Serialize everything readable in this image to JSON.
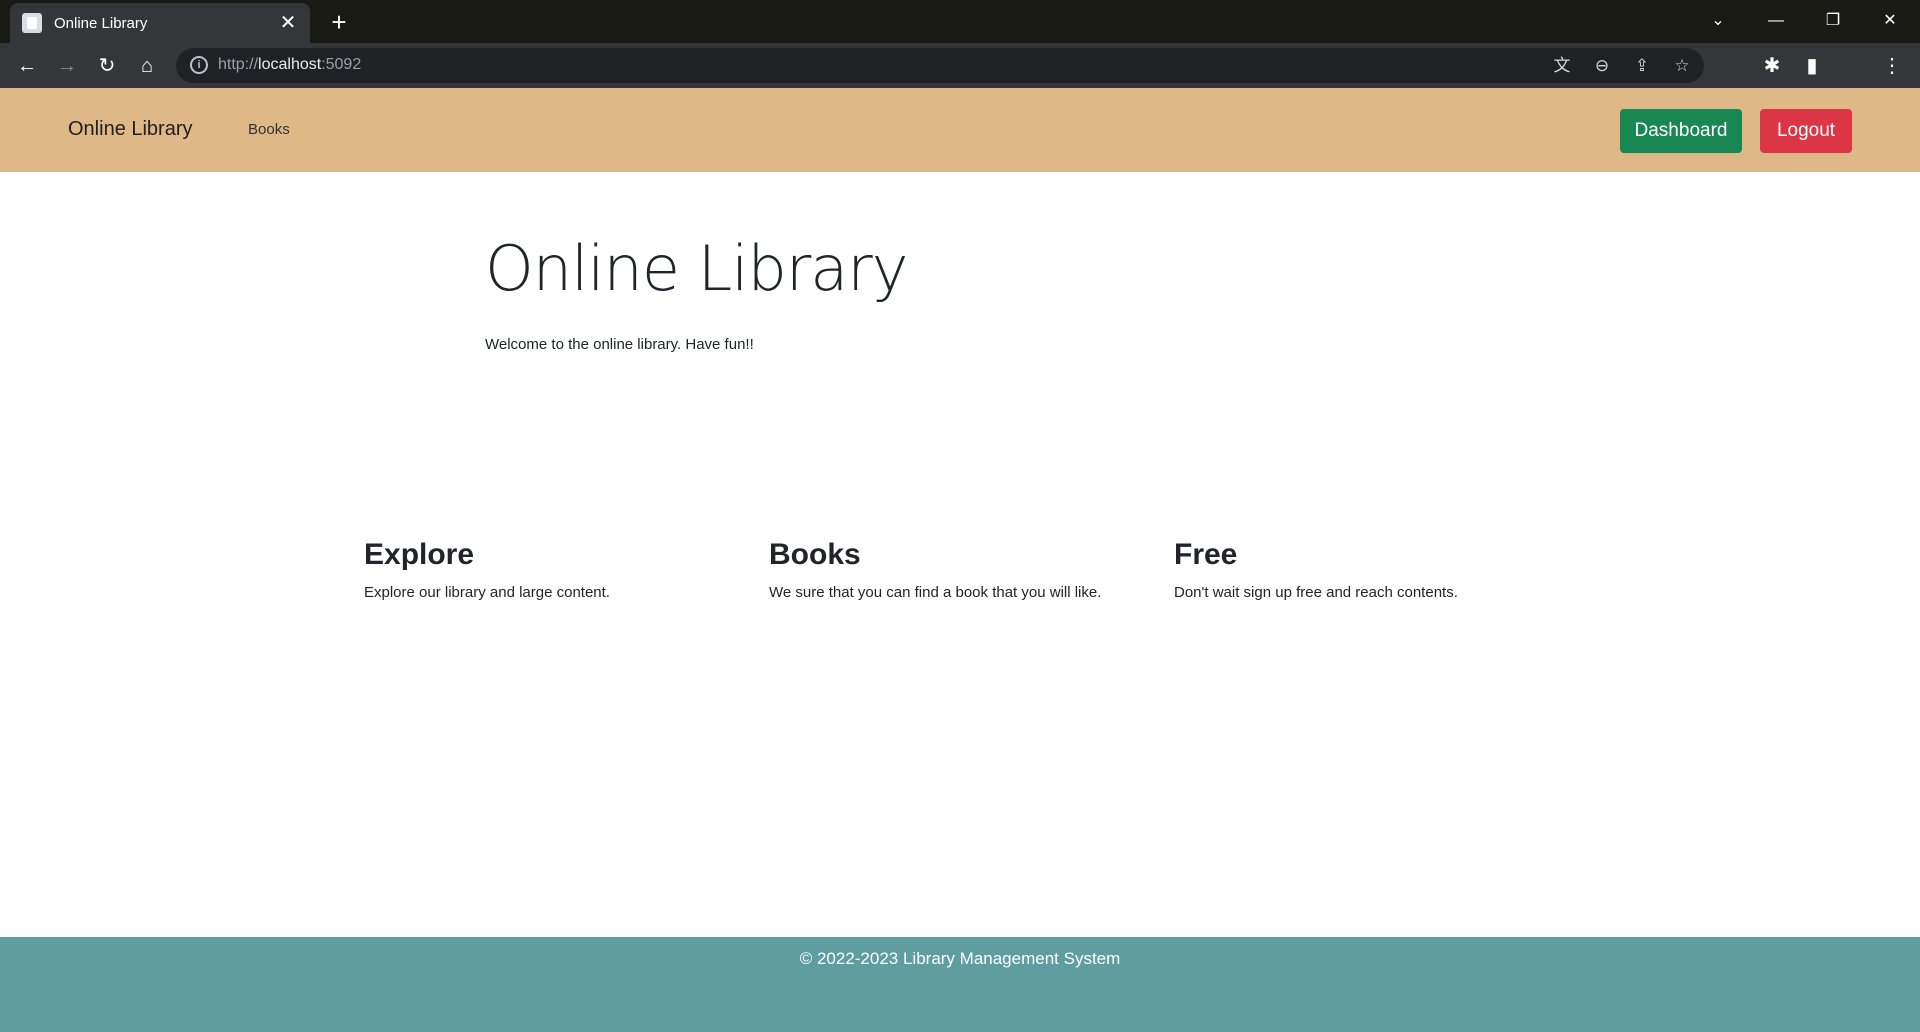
{
  "browser": {
    "tab_title": "Online Library",
    "tab_close": "✕",
    "new_tab": "+",
    "url_scheme": "http://",
    "url_host": "localhost",
    "url_port": ":5092",
    "window_controls": {
      "tab_search": "⌄",
      "minimize": "—",
      "restore": "❐",
      "close": "✕"
    },
    "toolbar_icons": {
      "back": "←",
      "forward": "→",
      "reload": "↻",
      "home": "⌂",
      "translate": "文",
      "zoom": "⊖",
      "share": "⇪",
      "bookmark": "☆",
      "extensions": "✱",
      "side_panel": "▮",
      "menu": "⋮"
    }
  },
  "navbar": {
    "brand": "Online Library",
    "links": [
      "Books"
    ],
    "dashboard_label": "Dashboard",
    "logout_label": "Logout",
    "background_color": "#deb887",
    "dashboard_color": "#198754",
    "logout_color": "#dc3545"
  },
  "hero": {
    "title": "Online Library",
    "subtitle": "Welcome to the online library. Have fun!!"
  },
  "features": [
    {
      "title": "Explore",
      "text": "Explore our library and large content."
    },
    {
      "title": "Books",
      "text": "We sure that you can find a book that you will like."
    },
    {
      "title": "Free",
      "text": "Don't wait sign up free and reach contents."
    }
  ],
  "footer": {
    "text": "© 2022-2023 Library Management System",
    "background_color": "#5f9ea0"
  }
}
